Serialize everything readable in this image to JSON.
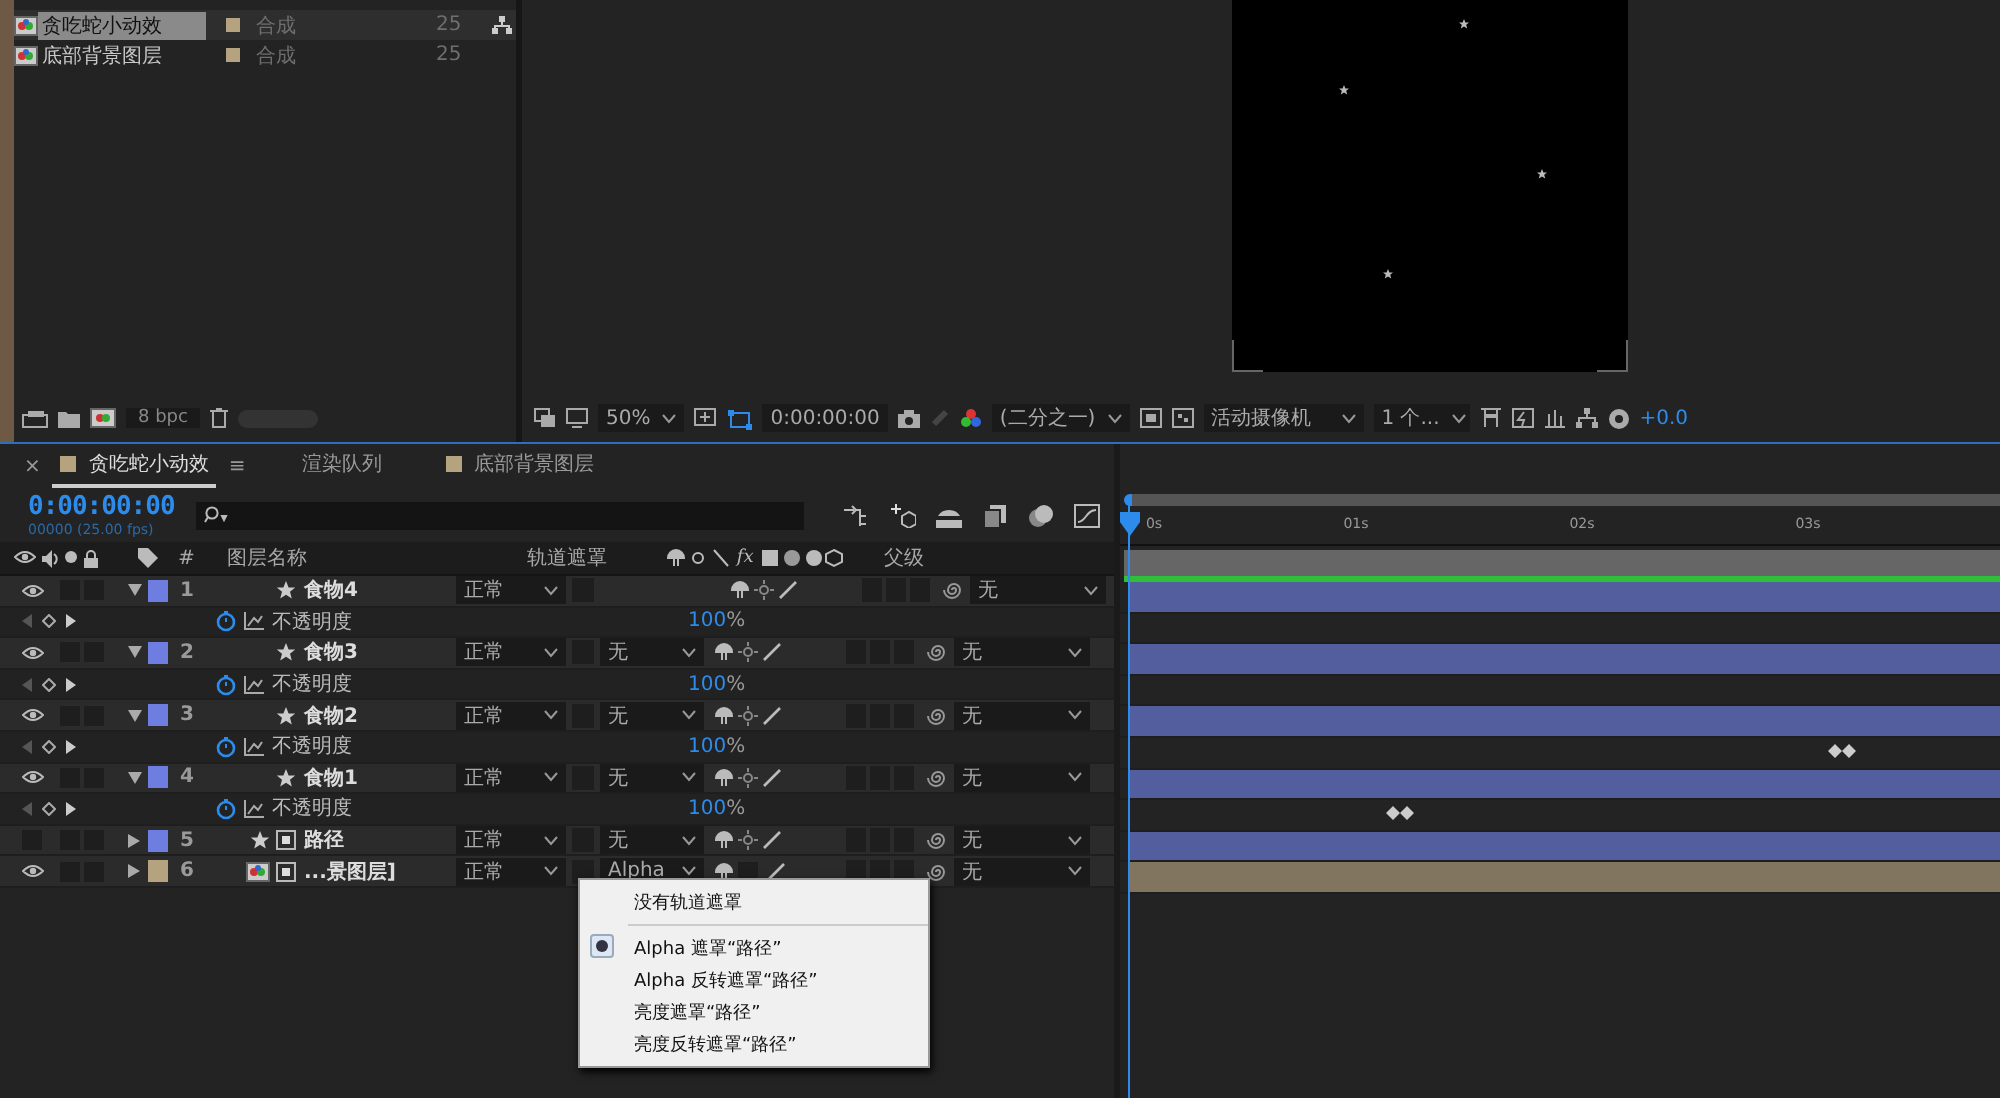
{
  "project": {
    "items": [
      {
        "name": "贪吃蛇小动效",
        "type": "合成",
        "rate": "25",
        "selected": true
      },
      {
        "name": "底部背景图层",
        "type": "合成",
        "rate": "25",
        "selected": false
      }
    ],
    "bit_depth": "8 bpc"
  },
  "viewer": {
    "toolbar": {
      "zoom": "50%",
      "time": "0:00:00:00",
      "resolution": "(二分之一)",
      "camera": "活动摄像机",
      "views": "1 个...",
      "exposure": "+0.0"
    }
  },
  "timeline": {
    "tabs": [
      {
        "label": "贪吃蛇小动效",
        "kind": "comp",
        "color": "#b5a27f",
        "selected": true
      },
      {
        "label": "渲染队列",
        "kind": "queue",
        "selected": false
      },
      {
        "label": "底部背景图层",
        "kind": "comp",
        "color": "#b5a27f",
        "selected": false
      }
    ],
    "close": "×",
    "menu": "≡",
    "time": "0:00:00:00",
    "frame_info": "00000 (25.00 fps)",
    "columns": {
      "number": "#",
      "layer_name": "图层名称",
      "track_matte": "轨道遮罩",
      "effects": "fx",
      "parent": "父级"
    },
    "ruler": [
      "0s",
      "01s",
      "02s",
      "03s"
    ],
    "layers": [
      {
        "number": "1",
        "name": "食物4",
        "kind": "star",
        "visible": true,
        "expanded": true,
        "color": "#6d7ee0",
        "mode": "正常",
        "parent": "无",
        "property": {
          "name": "不透明度",
          "value": "100",
          "unit": "%"
        }
      },
      {
        "number": "2",
        "name": "食物3",
        "kind": "star",
        "visible": true,
        "expanded": true,
        "color": "#6d7ee0",
        "mode": "正常",
        "matte": "无",
        "parent": "无",
        "property": {
          "name": "不透明度",
          "value": "100",
          "unit": "%"
        }
      },
      {
        "number": "3",
        "name": "食物2",
        "kind": "star",
        "visible": true,
        "expanded": true,
        "color": "#6d7ee0",
        "mode": "正常",
        "matte": "无",
        "parent": "无",
        "property": {
          "name": "不透明度",
          "value": "100",
          "unit": "%",
          "keyframe": {
            "level": 0.8
          }
        }
      },
      {
        "number": "4",
        "name": "食物1",
        "kind": "star",
        "visible": true,
        "expanded": true,
        "color": "#6d7ee0",
        "mode": "正常",
        "matte": "无",
        "parent": "无",
        "property": {
          "name": "不透明度",
          "value": "100",
          "unit": "%",
          "keyframe": {
            "level": 0.3
          }
        }
      },
      {
        "number": "5",
        "name": "路径",
        "kind": "star-shape",
        "visible": false,
        "expanded": false,
        "color": "#6d7ee0",
        "mode": "正常",
        "matte": "无",
        "parent": "无"
      },
      {
        "number": "6",
        "name": "...景图层]",
        "kind": "comp",
        "visible": true,
        "expanded": false,
        "color": "#b5a27f",
        "mode": "正常",
        "matte": "Alpha",
        "parent": "无"
      }
    ],
    "matte_menu": [
      {
        "label": "没有轨道遮罩",
        "selected": false
      },
      {
        "label": "Alpha 遮罩“路径”",
        "selected": true
      },
      {
        "label": "Alpha 反转遮罩“路径”",
        "selected": false
      },
      {
        "label": "亮度遮罩“路径”",
        "selected": false
      },
      {
        "label": "亮度反转遮罩“路径”",
        "selected": false
      }
    ]
  }
}
